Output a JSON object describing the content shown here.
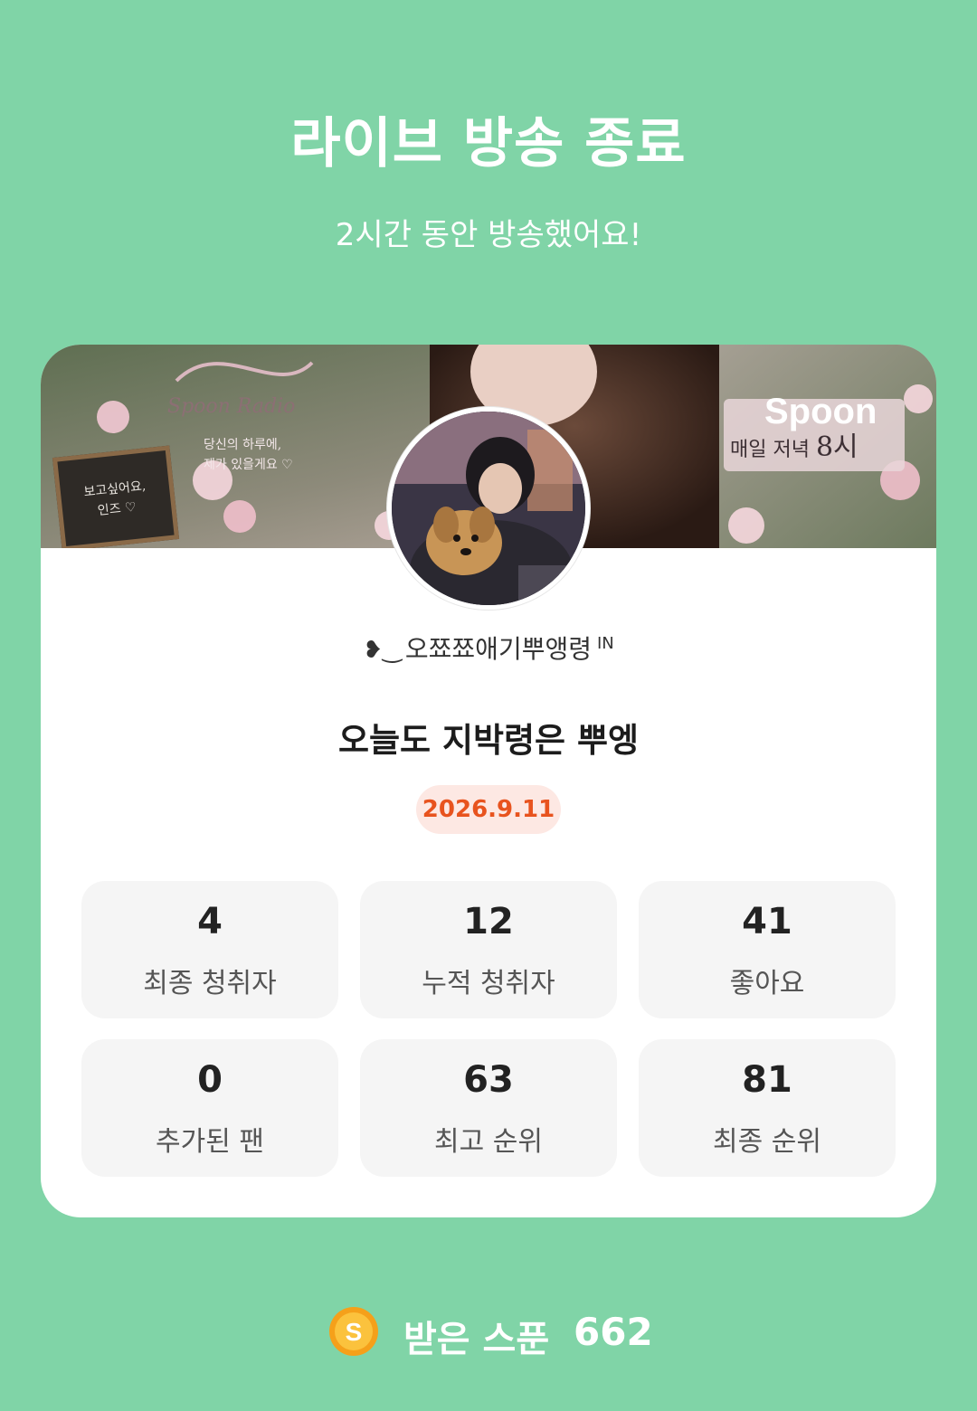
{
  "header": {
    "title": "라이브 방송 종료",
    "subtitle": "2시간 동안 방송했어요!"
  },
  "banner": {
    "brand": "Spoon",
    "schedule": "매일 저녁",
    "schedule_time": "8시",
    "script_text": "Spoon Radio",
    "message_line1": "당신의 하루에,",
    "message_line2": "제가 있을게요 ♡",
    "board_line1": "보고싶어요,",
    "board_line2": "인즈 ♡"
  },
  "host": {
    "name": "오쬬쬬애기뿌앵령",
    "badge": "IN",
    "decoration": "❥︎‿"
  },
  "broadcast": {
    "title": "오늘도 지박령은 뿌엥",
    "date": "2026.9.11"
  },
  "stats": [
    {
      "value": "4",
      "label": "최종 청취자"
    },
    {
      "value": "12",
      "label": "누적 청취자"
    },
    {
      "value": "41",
      "label": "좋아요"
    },
    {
      "value": "0",
      "label": "추가된 팬"
    },
    {
      "value": "63",
      "label": "최고 순위"
    },
    {
      "value": "81",
      "label": "최종 순위"
    }
  ],
  "spoons": {
    "icon": "spoon-coin-icon",
    "label": "받은 스푼",
    "count": "662"
  },
  "colors": {
    "background": "#80d4a7",
    "card": "#ffffff",
    "stat_tile": "#f5f5f5",
    "date_badge_bg": "#fde8e3",
    "date_badge_text": "#e8531e",
    "coin": "#f5a01a"
  }
}
